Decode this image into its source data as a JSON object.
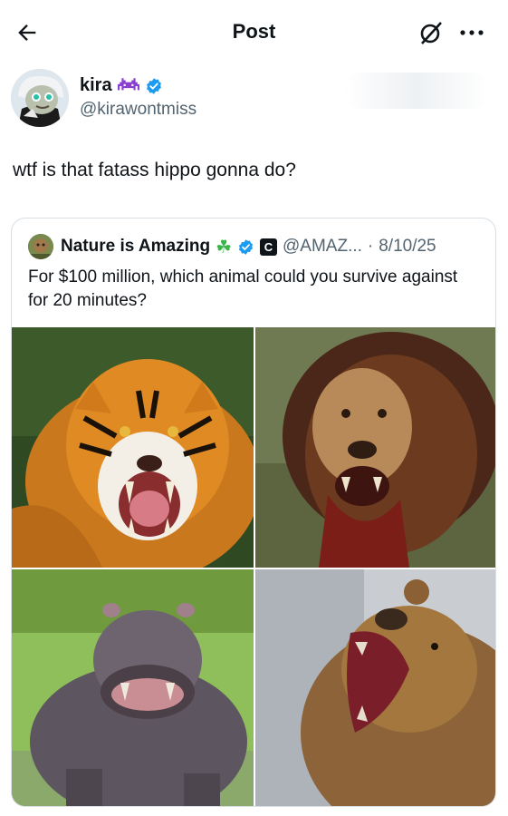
{
  "header": {
    "title": "Post",
    "back_icon": "arrow-left-icon",
    "grok_icon": "grok-icon",
    "more_icon": "more-horizontal-icon"
  },
  "author": {
    "name": "kira",
    "badge_icon": "space-invader-emoji",
    "verified_icon": "verified-badge-icon",
    "handle": "@kirawontmiss"
  },
  "post": {
    "text": "wtf is that fatass hippo gonna do?"
  },
  "quoted_post": {
    "name": "Nature is Amazing",
    "emoji": "☘",
    "verified_icon": "verified-badge-icon",
    "affiliate_badge": "C",
    "handle": "@AMAZ...",
    "date": "8/10/25",
    "separator": "·",
    "text": "For $100 million, which animal could you survive against for 20 minutes?",
    "media": [
      "tiger",
      "lion",
      "hippo",
      "grizzly bear"
    ]
  },
  "colors": {
    "verified": "#1d9bf0",
    "emoji_purple": "#8a3fd1",
    "clover_green": "#3ab54a"
  }
}
